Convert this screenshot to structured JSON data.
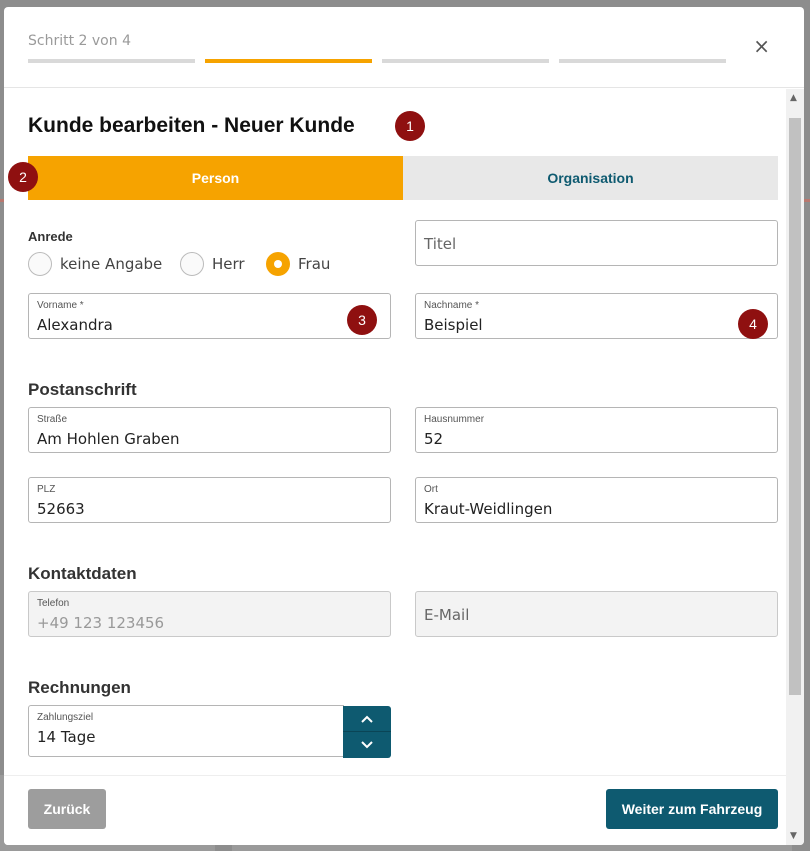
{
  "wizard": {
    "step_text": "Schritt 2 von 4",
    "steps_total": 4,
    "current_step": 2,
    "close_label": "×"
  },
  "dialog": {
    "title": "Kunde bearbeiten - Neuer Kunde"
  },
  "badges": [
    "1",
    "2",
    "3",
    "4"
  ],
  "tabs": [
    {
      "label": "Person",
      "active": true
    },
    {
      "label": "Organisation",
      "active": false
    }
  ],
  "anrede": {
    "label": "Anrede",
    "options": [
      "keine Angabe",
      "Herr",
      "Frau"
    ],
    "selected": "Frau"
  },
  "titel": {
    "placeholder": "Titel"
  },
  "vorname": {
    "label": "Vorname *",
    "value": "Alexandra"
  },
  "nachname": {
    "label": "Nachname *",
    "value": "Beispiel"
  },
  "postanschrift": {
    "heading": "Postanschrift",
    "strasse": {
      "label": "Straße",
      "value": "Am Hohlen Graben"
    },
    "hausnummer": {
      "label": "Hausnummer",
      "value": "52"
    },
    "plz": {
      "label": "PLZ",
      "value": "52663"
    },
    "ort": {
      "label": "Ort",
      "value": "Kraut-Weidlingen"
    }
  },
  "kontaktdaten": {
    "heading": "Kontaktdaten",
    "telefon": {
      "label": "Telefon",
      "placeholder": "+49 123 123456"
    },
    "email": {
      "placeholder": "E-Mail"
    }
  },
  "rechnungen": {
    "heading": "Rechnungen",
    "zahlungsziel": {
      "label": "Zahlungsziel",
      "value": "14 Tage"
    }
  },
  "footer": {
    "back_label": "Zurück",
    "next_label": "Weiter zum Fahrzeug"
  },
  "colors": {
    "accent": "#f6a300",
    "primary": "#0e5a70",
    "badge": "#8f1010"
  }
}
